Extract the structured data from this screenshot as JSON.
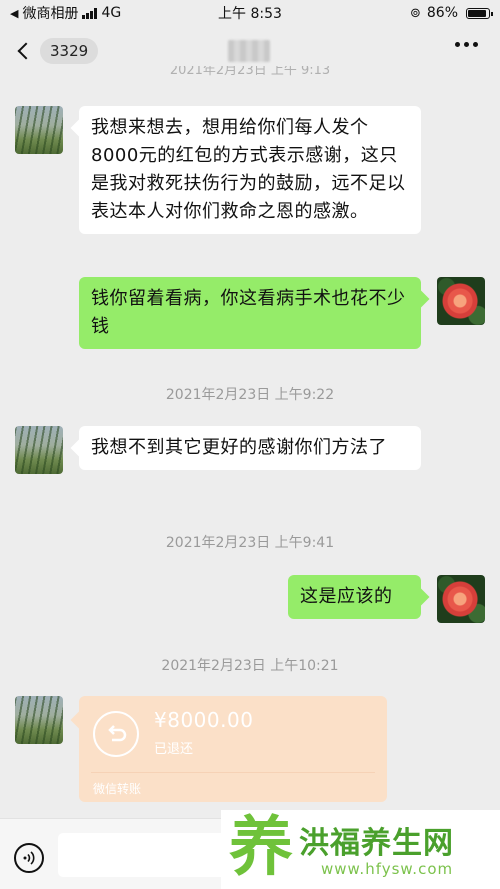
{
  "status_bar": {
    "carrier": "微商相册",
    "network": "4G",
    "time": "上午 8:53",
    "battery": "86%"
  },
  "nav": {
    "unread_count": "3329",
    "cut_timestamp": "2021年2月23日 上午 9:13"
  },
  "messages": [
    {
      "side": "left",
      "text": "我想来想去，想用给你们每人发个8000元的红包的方式表示感谢，这只是我对救死扶伤行为的鼓励，远不足以表达本人对你们救命之恩的感激。"
    },
    {
      "side": "right",
      "text": "钱你留着看病，你这看病手术也花不少钱"
    },
    {
      "timestamp": "2021年2月23日 上午9:22"
    },
    {
      "side": "left",
      "text": "我想不到其它更好的感谢你们方法了"
    },
    {
      "timestamp": "2021年2月23日 上午9:41"
    },
    {
      "side": "right",
      "text": "这是应该的"
    },
    {
      "timestamp": "2021年2月23日 上午10:21"
    }
  ],
  "transfer": {
    "amount": "¥8000.00",
    "status": "已退还",
    "footer": "微信转账"
  },
  "watermark": {
    "logo_char": "养",
    "title": "洪福养生网",
    "url": "www.hfysw.com"
  },
  "icons": {
    "back": "chevron-left-icon",
    "more": "ellipsis-icon",
    "voice": "voice-icon",
    "transfer": "refund-arrow-icon"
  },
  "colors": {
    "background": "#ededed",
    "bubble_self": "#95ec69",
    "bubble_other": "#ffffff",
    "transfer_refunded": "#fbe0c8"
  }
}
